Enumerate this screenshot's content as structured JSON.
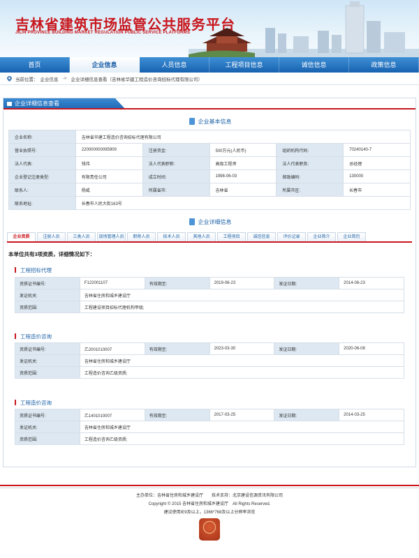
{
  "header": {
    "title": "吉林省建筑市场监管公共服务平台",
    "subtitle": "JILIN PROVINCE BUILDING MARKET REGULATION PUBLIC SERVICE PLATFORMS"
  },
  "nav": [
    "首页",
    "企业信息",
    "人员信息",
    "工程项目信息",
    "诚信信息",
    "政策信息"
  ],
  "breadcrumb": {
    "label": "当前位置：",
    "item1": "企业信息",
    "sep": "->",
    "item2": "企业详细信息查看（吉林省华建工程造价咨询招标代理有限公司）"
  },
  "panel_title": "企业详细信息查看",
  "basic": {
    "section_title": "企业基本信息",
    "company_label": "企业名称:",
    "company_name": "吉林省华建工程造价咨询招标代理有限公司",
    "rows": [
      [
        "营业执照号:",
        "220000000095909",
        "注册资金:",
        "500万元(人民币)",
        "组织机构代码:",
        "70240140-7"
      ],
      [
        "法人代表:",
        "钱伟",
        "法人代表职称:",
        "高级工程师",
        "法人代表职务:",
        "总经理"
      ],
      [
        "企业登记注册类型:",
        "有限责任公司",
        "成立时间:",
        "1998-06-03",
        "邮政编码:",
        "130000"
      ],
      [
        "联系人:",
        "杨威",
        "所属省市:",
        "吉林省",
        "所属市区:",
        "长春市"
      ]
    ],
    "address_label": "联系地址:",
    "address": "长春市人民大街163号"
  },
  "detail": {
    "section_title": "企业详细信息",
    "tabs": [
      "企业资质",
      "注册人员",
      "三类人员",
      "现场管理人员",
      "职称人员",
      "技术人员",
      "其他人员",
      "工程项目",
      "诚信信息",
      "评价记录",
      "企业简介",
      "企业简历"
    ],
    "summary": "本单位共有3项资质，详细情况如下："
  },
  "qualifications": [
    {
      "title": "工程招标代理",
      "cert_label": "资质证书编号:",
      "cert_no": "F122001107",
      "valid_label": "有效期至:",
      "valid_to": "2019-06-23",
      "issue_label": "发证日期:",
      "issue_date": "2014-06-23",
      "org_label": "发证机关:",
      "org": "吉林省住房和城乡建设厅",
      "scope_label": "资质范围:",
      "scope": "工程建设项目招标代理机构甲级;"
    },
    {
      "title": "工程造价咨询",
      "cert_label": "资质证书编号:",
      "cert_no": "乙2001010007",
      "valid_label": "有效期至:",
      "valid_to": "2023-03-30",
      "issue_label": "发证日期:",
      "issue_date": "2020-06-08",
      "org_label": "发证机关:",
      "org": "吉林省住房和城乡建设厅",
      "scope_label": "资质范围:",
      "scope": "工程造价咨询乙级资质;"
    },
    {
      "title": "工程造价咨询",
      "cert_label": "资质证书编号:",
      "cert_no": "乙1401010007",
      "valid_label": "有效期至:",
      "valid_to": "2017-03-25",
      "issue_label": "发证日期:",
      "issue_date": "2014-03-25",
      "org_label": "发证机关:",
      "org": "吉林省住房和城乡建设厅",
      "scope_label": "资质范围:",
      "scope": "工程造价咨询乙级资质;"
    }
  ],
  "footer": {
    "line1": "主办单位：吉林省住房和城乡建设厅　　技术支持：北京建设信源资讯有限公司",
    "line2": "Copyright © 2015 吉林省住房和城乡建设厅　All Rights Reserved.",
    "line3": "建议使用IE9及以上，1366*768及以上分辨率浏览"
  },
  "colors": {
    "brand_red": "#c8161d",
    "nav_blue": "#1862b0",
    "label_bg": "#dde8f2"
  },
  "icons": {
    "breadcrumb": "location-pin-icon",
    "panel": "folder-icon",
    "section": "document-icon",
    "footer_seal": "seal-icon"
  }
}
